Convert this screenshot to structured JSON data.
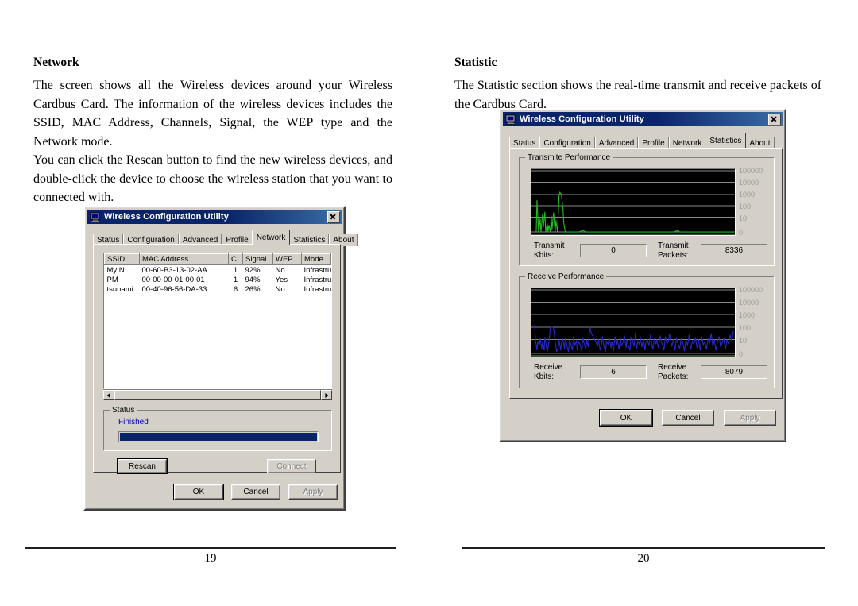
{
  "document": {
    "left_page": {
      "heading": "Network",
      "paragraph1": "The screen shows all the Wireless devices around your Wireless Cardbus Card. The information of the wireless devices includes the SSID, MAC Address, Channels, Signal, the WEP type and the Network mode.",
      "paragraph2": "You can click the Rescan button to find the new wireless devices, and double-click the device to choose the wireless station that you want to connected with.",
      "page_number": "19"
    },
    "right_page": {
      "heading": "Statistic",
      "paragraph1": "The Statistic section shows the real-time transmit and receive packets of the Cardbus Card.",
      "page_number": "20"
    }
  },
  "network_dialog": {
    "title": "Wireless Configuration Utility",
    "title_icon": "computer-icon",
    "close_label": "×",
    "tabs": [
      {
        "label": "Status",
        "selected": false
      },
      {
        "label": "Configuration",
        "selected": false
      },
      {
        "label": "Advanced",
        "selected": false
      },
      {
        "label": "Profile",
        "selected": false
      },
      {
        "label": "Network",
        "selected": true
      },
      {
        "label": "Statistics",
        "selected": false
      },
      {
        "label": "About",
        "selected": false
      }
    ],
    "table": {
      "columns": [
        "SSID",
        "MAC Address",
        "C.",
        "Signal",
        "WEP",
        "Mode"
      ],
      "rows": [
        [
          "My N...",
          "00-60-B3-13-02-AA",
          "1",
          "92%",
          "No",
          "Infrastructure"
        ],
        [
          "PM",
          "00-00-00-01-00-01",
          "1",
          "94%",
          "Yes",
          "Infrastructure"
        ],
        [
          "tsunami",
          "00-40-96-56-DA-33",
          "6",
          "26%",
          "No",
          "Infrastructure"
        ]
      ]
    },
    "scrollbar": {
      "left_arrow": "scroll-left-icon",
      "right_arrow": "scroll-right-icon"
    },
    "status_group": {
      "label": "Status",
      "text": "Finished",
      "text_color": "#0000cc",
      "progress_percent": 100,
      "progress_color": "#0a246a"
    },
    "buttons": {
      "rescan": {
        "label": "Rescan",
        "disabled": false
      },
      "connect": {
        "label": "Connect",
        "disabled": true
      },
      "ok": {
        "label": "OK",
        "disabled": false
      },
      "cancel": {
        "label": "Cancel",
        "disabled": false
      },
      "apply": {
        "label": "Apply",
        "disabled": true
      }
    }
  },
  "statistics_dialog": {
    "title": "Wireless Configuration Utility",
    "title_icon": "computer-icon",
    "close_label": "×",
    "tabs": [
      {
        "label": "Status",
        "selected": false
      },
      {
        "label": "Configuration",
        "selected": false
      },
      {
        "label": "Advanced",
        "selected": false
      },
      {
        "label": "Profile",
        "selected": false
      },
      {
        "label": "Network",
        "selected": false
      },
      {
        "label": "Statistics",
        "selected": true
      },
      {
        "label": "About",
        "selected": false
      }
    ],
    "transmit_group": {
      "label": "Transmite Performance",
      "y_ticks": [
        "100000",
        "10000",
        "1000",
        "100",
        "10",
        "0"
      ],
      "trace_color": "#22bb22",
      "fields": [
        {
          "label_line1": "Transmit",
          "label_line2": "Kbits:",
          "value": "0"
        },
        {
          "label_line1": "Transmit",
          "label_line2": "Packets:",
          "value": "8336"
        }
      ]
    },
    "receive_group": {
      "label": "Receive Performance",
      "y_ticks": [
        "100000",
        "10000",
        "1000",
        "100",
        "10",
        "0"
      ],
      "trace_color": "#2222cc",
      "fields": [
        {
          "label_line1": "Receive",
          "label_line2": "Kbits:",
          "value": "6"
        },
        {
          "label_line1": "Receive",
          "label_line2": "Packets:",
          "value": "8079"
        }
      ]
    },
    "buttons": {
      "ok": {
        "label": "OK",
        "disabled": false
      },
      "cancel": {
        "label": "Cancel",
        "disabled": false
      },
      "apply": {
        "label": "Apply",
        "disabled": true
      }
    }
  },
  "chart_data": [
    {
      "type": "line",
      "title": "Transmite Performance",
      "ylabel": "",
      "xlabel": "",
      "y_scale": "log",
      "y_ticks": [
        100000,
        10000,
        1000,
        100,
        10,
        0
      ],
      "series": [
        {
          "name": "Transmit Kbits",
          "color": "#22bb22",
          "values": [
            0,
            900,
            40,
            0,
            30,
            0,
            160,
            20,
            200,
            25,
            0,
            12,
            0,
            1400,
            900,
            120,
            8,
            0,
            0,
            0,
            0,
            0,
            0,
            0,
            0,
            1,
            0,
            0,
            0,
            0,
            0,
            0,
            0,
            0,
            0,
            0,
            0,
            0,
            0,
            0,
            0,
            0,
            0,
            0,
            0,
            0,
            0,
            0,
            0,
            0,
            0,
            0,
            0,
            0,
            0,
            0,
            0,
            0,
            0,
            0,
            0,
            0,
            0,
            0,
            0,
            0,
            0,
            0,
            0,
            0,
            0,
            0,
            0,
            0,
            0,
            0,
            0,
            0,
            0,
            1,
            0,
            0,
            0,
            0,
            0,
            0,
            0,
            0,
            0,
            0
          ]
        }
      ]
    },
    {
      "type": "line",
      "title": "Receive Performance",
      "ylabel": "",
      "xlabel": "",
      "y_scale": "log",
      "y_ticks": [
        100000,
        10000,
        1000,
        100,
        10,
        0
      ],
      "series": [
        {
          "name": "Receive Kbits",
          "color": "#2222cc",
          "values": [
            120,
            10,
            2,
            14,
            8,
            16,
            5,
            12,
            4,
            18,
            6,
            3,
            10,
            90,
            95,
            88,
            12,
            2,
            4,
            9,
            3,
            7,
            12,
            4,
            16,
            6,
            2,
            14,
            8,
            3,
            18,
            7,
            10,
            4,
            12,
            6,
            2,
            15,
            8,
            4,
            11,
            5,
            95,
            40,
            22,
            16,
            10,
            6,
            13,
            4,
            9,
            17,
            6,
            2,
            12,
            8,
            14,
            5,
            10,
            3,
            16,
            7,
            11,
            4,
            13,
            6,
            9,
            15,
            5,
            12,
            8,
            3,
            14,
            10,
            6,
            16,
            4,
            11,
            7,
            13,
            5,
            9,
            12,
            6,
            15,
            8,
            4,
            10,
            14,
            7,
            11,
            5,
            13,
            9,
            16,
            6,
            12,
            8,
            4,
            18
          ]
        }
      ]
    }
  ]
}
